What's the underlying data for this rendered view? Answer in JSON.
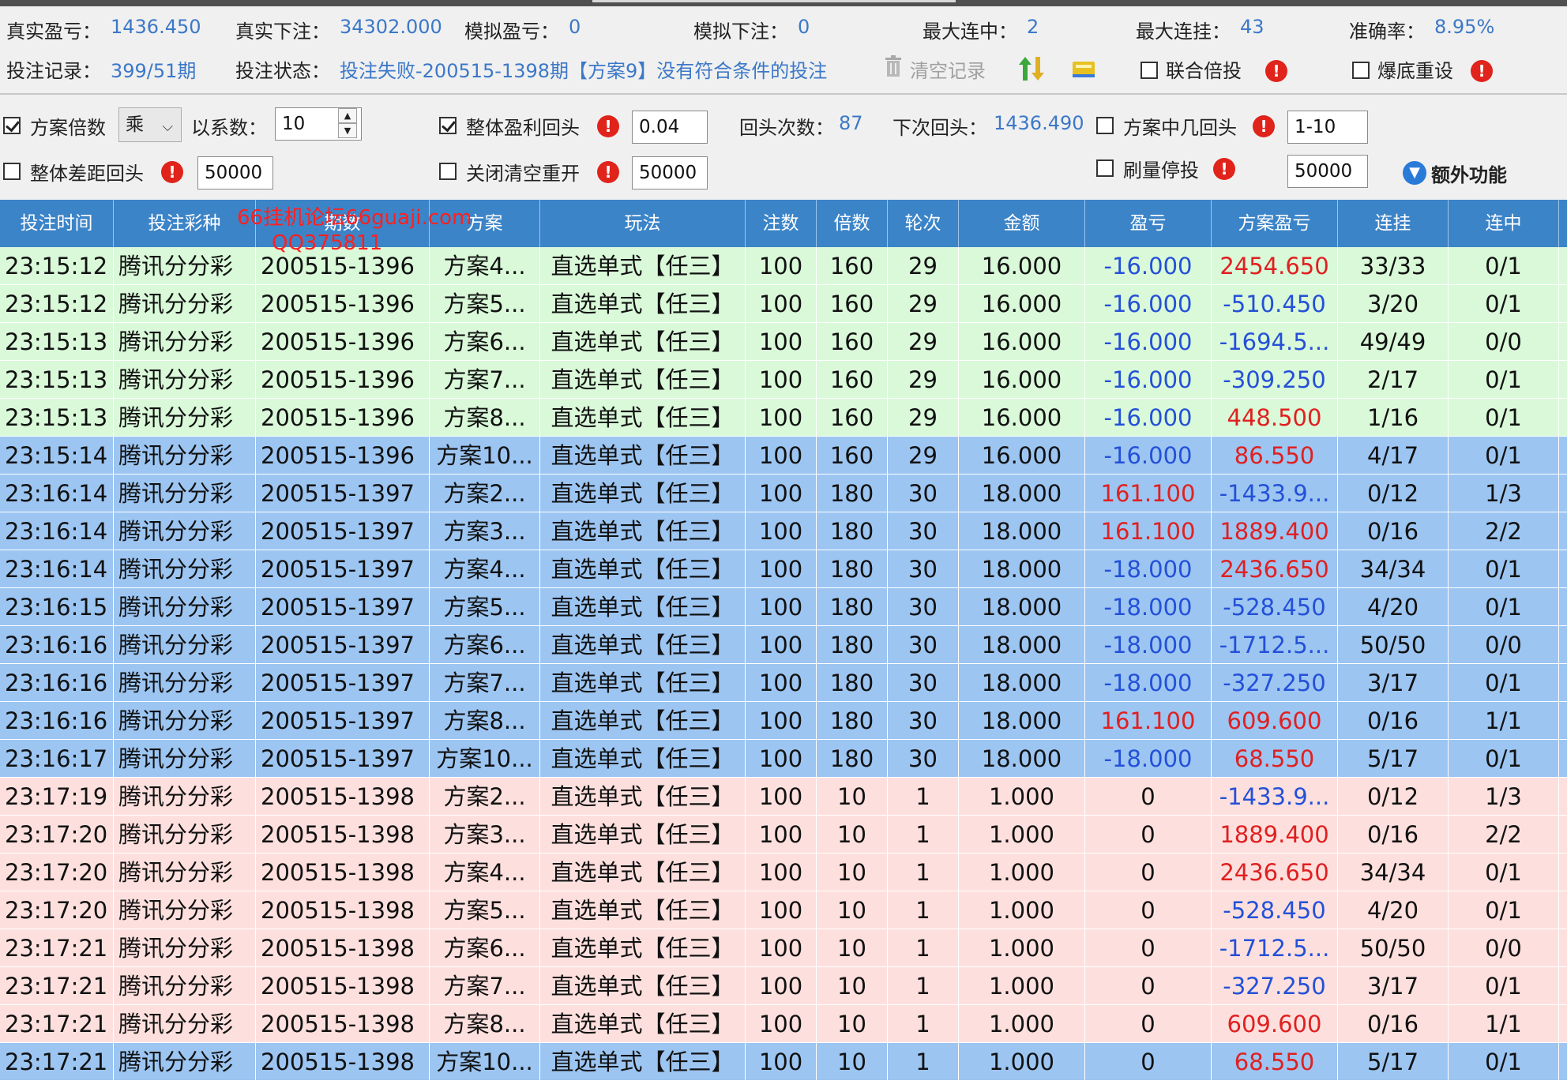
{
  "stats": {
    "real_pl_label": "真实盈亏：",
    "real_pl": "1436.450",
    "real_bet_label": "真实下注：",
    "real_bet": "34302.000",
    "sim_pl_label": "模拟盈亏：",
    "sim_pl": "0",
    "sim_bet_label": "模拟下注：",
    "sim_bet": "0",
    "max_hit_label": "最大连中：",
    "max_hit": "2",
    "max_miss_label": "最大连挂：",
    "max_miss": "43",
    "accuracy_label": "准确率：",
    "accuracy": "8.95%",
    "record_label": "投注记录：",
    "record": "399/51期",
    "status_label": "投注状态：",
    "status": "投注失败-200515-1398期【方案9】没有符合条件的投注",
    "clear_label": "清空记录",
    "joint_label": "联合倍投",
    "reset_label": "爆底重设"
  },
  "controls": {
    "scheme_mult_label": "方案倍数",
    "op_value": "乘",
    "coef_label": "以系数：",
    "coef_value": "10",
    "overall_profit_label": "整体盈利回头",
    "overall_profit_value": "0.04",
    "back_count_label": "回头次数：",
    "back_count": "87",
    "next_back_label": "下次回头：",
    "next_back": "1436.490",
    "scheme_hit_label": "方案中几回头",
    "scheme_hit_value": "1-10",
    "overall_diff_label": "整体差距回头",
    "overall_diff_value": "50000",
    "close_clear_label": "关闭清空重开",
    "close_clear_value": "50000",
    "stop_label": "刷量停投",
    "stop_value": "50000",
    "extra_label": "额外功能"
  },
  "watermark": {
    "line1": "66挂机论坛66guaji.com",
    "line2": "QQ375811"
  },
  "table": {
    "headers": [
      "投注时间",
      "投注彩种",
      "期数",
      "方案",
      "玩法",
      "注数",
      "倍数",
      "轮次",
      "金额",
      "盈亏",
      "方案盈亏",
      "连挂",
      "连中"
    ],
    "rows": [
      {
        "bg": "green",
        "cells": [
          "23:15:12",
          "腾讯分分彩",
          "200515-1396",
          "方案4...",
          "直选单式【任三】",
          "100",
          "160",
          "29",
          "16.000",
          "-16.000",
          "2454.650",
          "33/33",
          "0/1"
        ],
        "pl": "neg",
        "spl": "pos"
      },
      {
        "bg": "green",
        "cells": [
          "23:15:12",
          "腾讯分分彩",
          "200515-1396",
          "方案5...",
          "直选单式【任三】",
          "100",
          "160",
          "29",
          "16.000",
          "-16.000",
          "-510.450",
          "3/20",
          "0/1"
        ],
        "pl": "neg",
        "spl": "neg"
      },
      {
        "bg": "green",
        "cells": [
          "23:15:13",
          "腾讯分分彩",
          "200515-1396",
          "方案6...",
          "直选单式【任三】",
          "100",
          "160",
          "29",
          "16.000",
          "-16.000",
          "-1694.5...",
          "49/49",
          "0/0"
        ],
        "pl": "neg",
        "spl": "neg"
      },
      {
        "bg": "green",
        "cells": [
          "23:15:13",
          "腾讯分分彩",
          "200515-1396",
          "方案7...",
          "直选单式【任三】",
          "100",
          "160",
          "29",
          "16.000",
          "-16.000",
          "-309.250",
          "2/17",
          "0/1"
        ],
        "pl": "neg",
        "spl": "neg"
      },
      {
        "bg": "green",
        "cells": [
          "23:15:13",
          "腾讯分分彩",
          "200515-1396",
          "方案8...",
          "直选单式【任三】",
          "100",
          "160",
          "29",
          "16.000",
          "-16.000",
          "448.500",
          "1/16",
          "0/1"
        ],
        "pl": "neg",
        "spl": "pos"
      },
      {
        "bg": "blue",
        "cells": [
          "23:15:14",
          "腾讯分分彩",
          "200515-1396",
          "方案10...",
          "直选单式【任三】",
          "100",
          "160",
          "29",
          "16.000",
          "-16.000",
          "86.550",
          "4/17",
          "0/1"
        ],
        "pl": "neg",
        "spl": "pos"
      },
      {
        "bg": "blue",
        "cells": [
          "23:16:14",
          "腾讯分分彩",
          "200515-1397",
          "方案2...",
          "直选单式【任三】",
          "100",
          "180",
          "30",
          "18.000",
          "161.100",
          "-1433.9...",
          "0/12",
          "1/3"
        ],
        "pl": "pos",
        "spl": "neg"
      },
      {
        "bg": "blue",
        "cells": [
          "23:16:14",
          "腾讯分分彩",
          "200515-1397",
          "方案3...",
          "直选单式【任三】",
          "100",
          "180",
          "30",
          "18.000",
          "161.100",
          "1889.400",
          "0/16",
          "2/2"
        ],
        "pl": "pos",
        "spl": "pos"
      },
      {
        "bg": "blue",
        "cells": [
          "23:16:14",
          "腾讯分分彩",
          "200515-1397",
          "方案4...",
          "直选单式【任三】",
          "100",
          "180",
          "30",
          "18.000",
          "-18.000",
          "2436.650",
          "34/34",
          "0/1"
        ],
        "pl": "neg",
        "spl": "pos"
      },
      {
        "bg": "blue",
        "cells": [
          "23:16:15",
          "腾讯分分彩",
          "200515-1397",
          "方案5...",
          "直选单式【任三】",
          "100",
          "180",
          "30",
          "18.000",
          "-18.000",
          "-528.450",
          "4/20",
          "0/1"
        ],
        "pl": "neg",
        "spl": "neg"
      },
      {
        "bg": "blue",
        "cells": [
          "23:16:16",
          "腾讯分分彩",
          "200515-1397",
          "方案6...",
          "直选单式【任三】",
          "100",
          "180",
          "30",
          "18.000",
          "-18.000",
          "-1712.5...",
          "50/50",
          "0/0"
        ],
        "pl": "neg",
        "spl": "neg"
      },
      {
        "bg": "blue",
        "cells": [
          "23:16:16",
          "腾讯分分彩",
          "200515-1397",
          "方案7...",
          "直选单式【任三】",
          "100",
          "180",
          "30",
          "18.000",
          "-18.000",
          "-327.250",
          "3/17",
          "0/1"
        ],
        "pl": "neg",
        "spl": "neg"
      },
      {
        "bg": "blue",
        "cells": [
          "23:16:16",
          "腾讯分分彩",
          "200515-1397",
          "方案8...",
          "直选单式【任三】",
          "100",
          "180",
          "30",
          "18.000",
          "161.100",
          "609.600",
          "0/16",
          "1/1"
        ],
        "pl": "pos",
        "spl": "pos"
      },
      {
        "bg": "blue",
        "cells": [
          "23:16:17",
          "腾讯分分彩",
          "200515-1397",
          "方案10...",
          "直选单式【任三】",
          "100",
          "180",
          "30",
          "18.000",
          "-18.000",
          "68.550",
          "5/17",
          "0/1"
        ],
        "pl": "neg",
        "spl": "pos"
      },
      {
        "bg": "pink",
        "cells": [
          "23:17:19",
          "腾讯分分彩",
          "200515-1398",
          "方案2...",
          "直选单式【任三】",
          "100",
          "10",
          "1",
          "1.000",
          "0",
          "-1433.9...",
          "0/12",
          "1/3"
        ],
        "pl": "",
        "spl": "neg"
      },
      {
        "bg": "pink",
        "cells": [
          "23:17:20",
          "腾讯分分彩",
          "200515-1398",
          "方案3...",
          "直选单式【任三】",
          "100",
          "10",
          "1",
          "1.000",
          "0",
          "1889.400",
          "0/16",
          "2/2"
        ],
        "pl": "",
        "spl": "pos"
      },
      {
        "bg": "pink",
        "cells": [
          "23:17:20",
          "腾讯分分彩",
          "200515-1398",
          "方案4...",
          "直选单式【任三】",
          "100",
          "10",
          "1",
          "1.000",
          "0",
          "2436.650",
          "34/34",
          "0/1"
        ],
        "pl": "",
        "spl": "pos"
      },
      {
        "bg": "pink",
        "cells": [
          "23:17:20",
          "腾讯分分彩",
          "200515-1398",
          "方案5...",
          "直选单式【任三】",
          "100",
          "10",
          "1",
          "1.000",
          "0",
          "-528.450",
          "4/20",
          "0/1"
        ],
        "pl": "",
        "spl": "neg"
      },
      {
        "bg": "pink",
        "cells": [
          "23:17:21",
          "腾讯分分彩",
          "200515-1398",
          "方案6...",
          "直选单式【任三】",
          "100",
          "10",
          "1",
          "1.000",
          "0",
          "-1712.5...",
          "50/50",
          "0/0"
        ],
        "pl": "",
        "spl": "neg"
      },
      {
        "bg": "pink",
        "cells": [
          "23:17:21",
          "腾讯分分彩",
          "200515-1398",
          "方案7...",
          "直选单式【任三】",
          "100",
          "10",
          "1",
          "1.000",
          "0",
          "-327.250",
          "3/17",
          "0/1"
        ],
        "pl": "",
        "spl": "neg"
      },
      {
        "bg": "pink",
        "cells": [
          "23:17:21",
          "腾讯分分彩",
          "200515-1398",
          "方案8...",
          "直选单式【任三】",
          "100",
          "10",
          "1",
          "1.000",
          "0",
          "609.600",
          "0/16",
          "1/1"
        ],
        "pl": "",
        "spl": "pos"
      },
      {
        "bg": "blue",
        "cells": [
          "23:17:21",
          "腾讯分分彩",
          "200515-1398",
          "方案10...",
          "直选单式【任三】",
          "100",
          "10",
          "1",
          "1.000",
          "0",
          "68.550",
          "5/17",
          "0/1"
        ],
        "pl": "",
        "spl": "pos"
      }
    ]
  },
  "colors": {
    "header_bg": "#3c84c8",
    "green_row": "#d9f9d9",
    "blue_row": "#9cc5f2",
    "pink_row": "#fde0de",
    "value_blue": "#3c78c8",
    "neg": "#2450d8",
    "pos": "#e02020"
  }
}
